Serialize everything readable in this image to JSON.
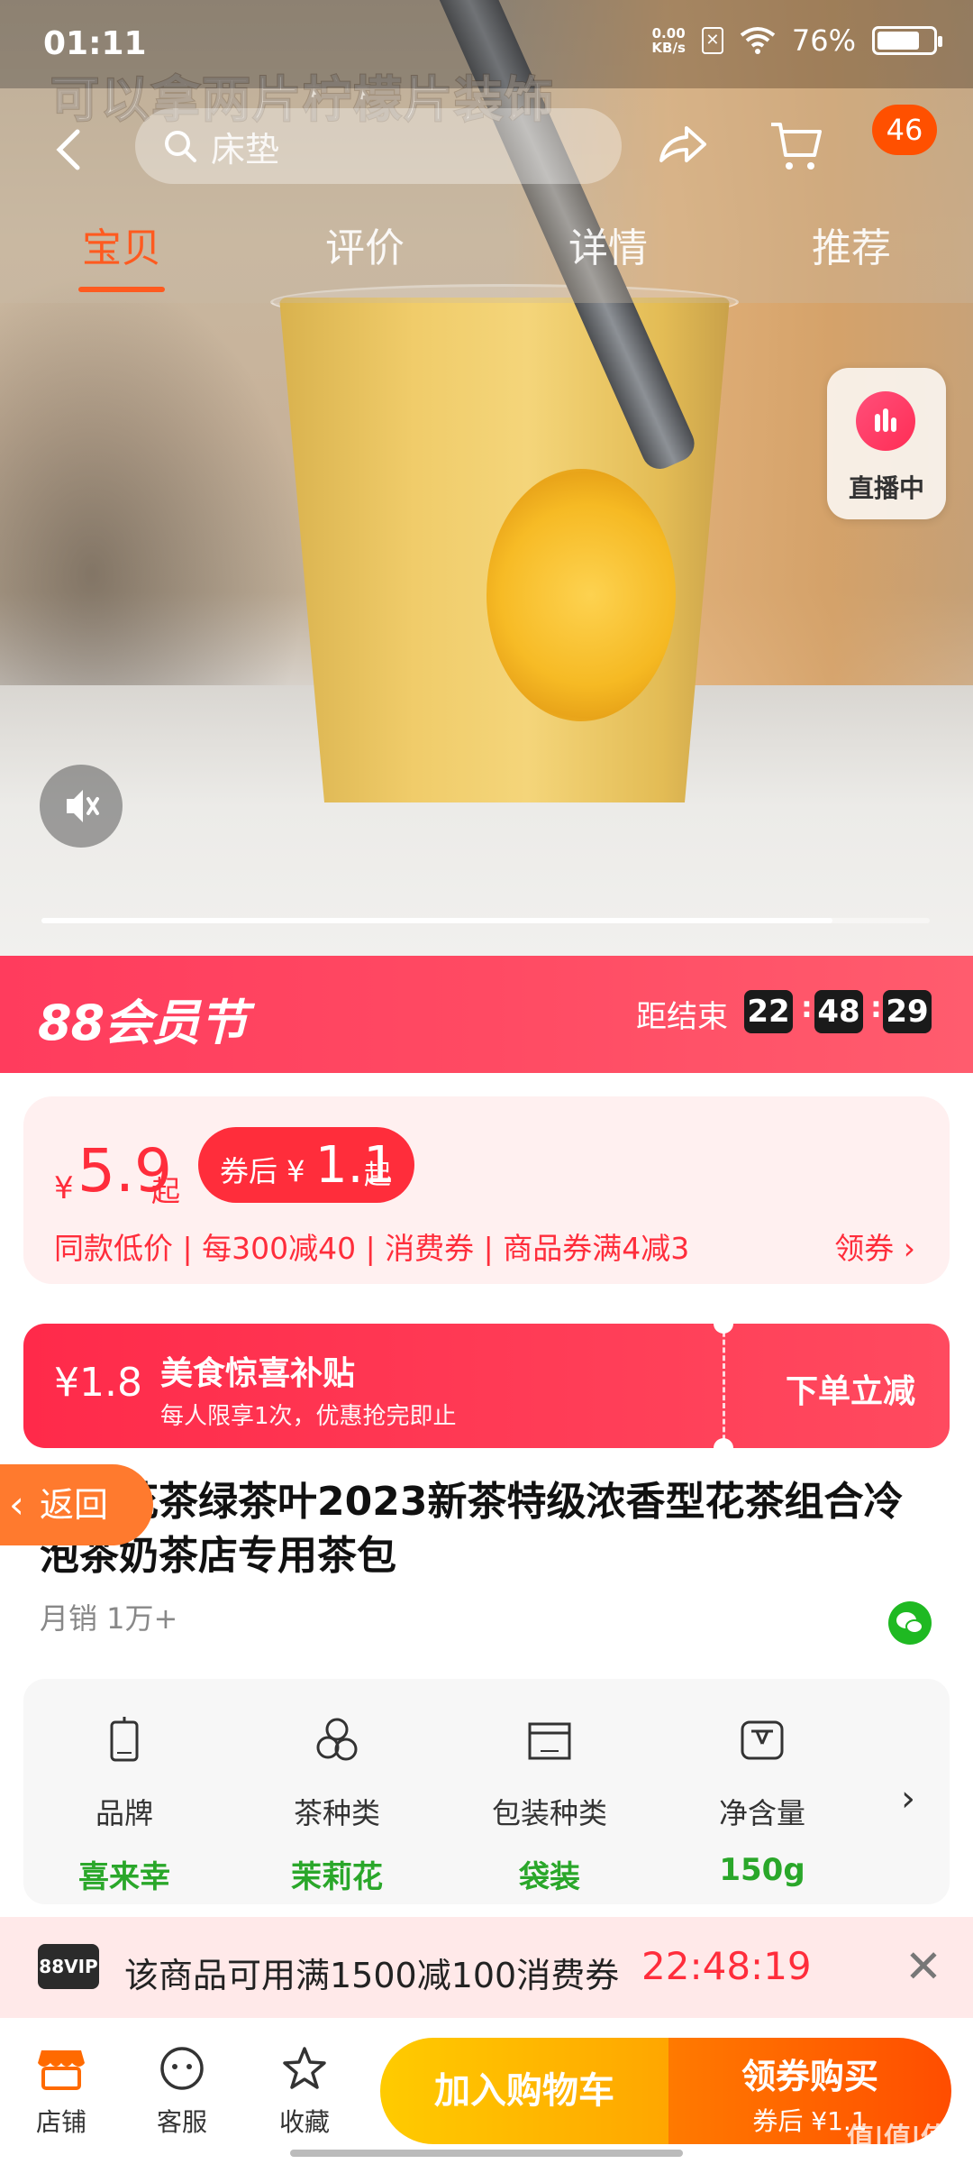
{
  "status_bar": {
    "time": "01:11",
    "net_speed_value": "0.00",
    "net_speed_unit": "KB/s",
    "battery": "76%",
    "battery_level": 0.76
  },
  "video": {
    "caption": "可以拿两片柠檬片装饰",
    "live_label": "直播中",
    "progress": 0.89
  },
  "nav": {
    "search_placeholder": "床垫",
    "cart_count": "46",
    "tabs": [
      {
        "label": "宝贝",
        "active": true
      },
      {
        "label": "评价"
      },
      {
        "label": "详情"
      },
      {
        "label": "推荐"
      }
    ]
  },
  "festival": {
    "logo": "88会员节",
    "ends_label": "距结束",
    "hours": "22",
    "minutes": "48",
    "seconds": "29"
  },
  "price": {
    "currency": "¥",
    "value": "5.9",
    "suffix": "起",
    "coupon_prefix": "券后 ¥",
    "coupon_value": "1.1",
    "coupon_suffix": "起",
    "promo_line": "同款低价 | 每300减40 | 消费券 | 商品券满4减3",
    "get_coupon": "领券"
  },
  "subsidy": {
    "amount": "¥1.8",
    "title": "美食惊喜补贴",
    "subtitle": "每人限享1次，优惠抢完即止",
    "action": "下单立减"
  },
  "back_float": "返回",
  "product": {
    "title": "茉莉花茶绿茶叶2023新茶特级浓香型花茶组合冷泡茶奶茶店专用茶包",
    "sales": "月销 1万+"
  },
  "attributes": [
    {
      "key": "品牌",
      "value": "喜来幸",
      "icon": "tag-icon"
    },
    {
      "key": "茶种类",
      "value": "茉莉花",
      "icon": "tea-leaves-icon"
    },
    {
      "key": "包装种类",
      "value": "袋装",
      "icon": "box-icon"
    },
    {
      "key": "净含量",
      "value": "150g",
      "icon": "scale-icon"
    }
  ],
  "vip": {
    "badge": "88VIP",
    "text": "该商品可用满1500减100消费券",
    "time": "22:48:19"
  },
  "bottom_bar": {
    "shop": "店铺",
    "service": "客服",
    "favorite": "收藏",
    "add_cart": "加入购物车",
    "buy": "领券购买",
    "buy_sub": "券后 ¥1.1",
    "watermark": "值|值|值"
  },
  "colors": {
    "accent": "#ff2d3b",
    "orange": "#ff5000",
    "green": "#2aa72a"
  }
}
